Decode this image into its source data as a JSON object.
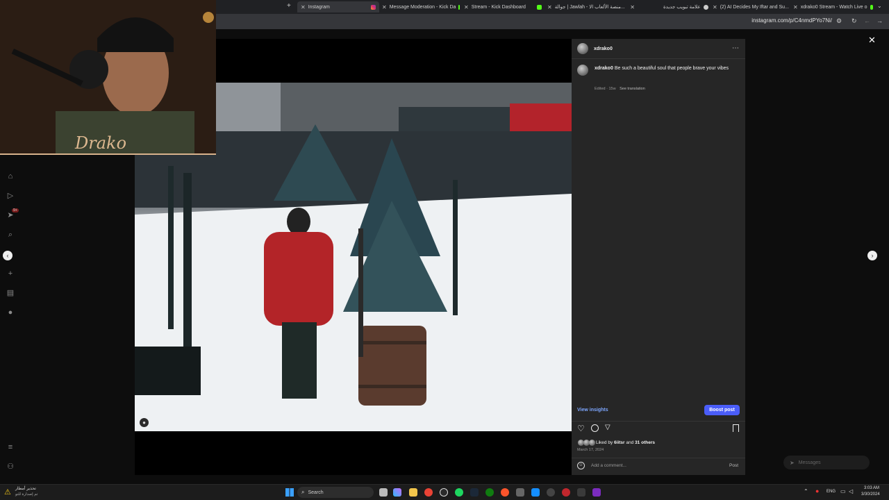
{
  "browser": {
    "tabs": [
      {
        "label": "Instagram",
        "active": true
      },
      {
        "label": "Message Moderation - Kick Da"
      },
      {
        "label": "Stream - Kick Dashboard"
      },
      {
        "label": "جوالة | Jawlah - منصة الألعاب الا..."
      },
      {
        "label": "علامة تبويب جديدة"
      },
      {
        "label": "(2) AI Decides My Iftar and Su..."
      },
      {
        "label": "xdrako0 Stream - Watch Live o"
      }
    ],
    "url": "instagram.com/p/C4nmdPYo7Ni/"
  },
  "webcam": {
    "signature": "Drako"
  },
  "sidebar": {
    "badge": "9+"
  },
  "post": {
    "username": "xdrako0",
    "caption_user": "xdrako0",
    "caption_text": "Be such a beautiful soul that people brave your vibes",
    "edited": "Edited · 15w",
    "see_translation": "See translation",
    "view_insights": "View insights",
    "boost_post": "Boost post",
    "liked_prefix": "Liked by",
    "liked_user": "6iitsr",
    "liked_and": "and",
    "liked_others": "31 others",
    "date": "March 17, 2024",
    "comment_placeholder": "Add a comment...",
    "post_button": "Post"
  },
  "messages_pill": {
    "label": "Messages"
  },
  "taskbar": {
    "weather_title": "تحذير أمطار",
    "weather_sub": "تم إصدارة للتو",
    "search_label": "Search",
    "lang": "ENG",
    "time": "3:03 AM",
    "date": "3/30/2024"
  },
  "colors": {
    "accent": "#4a5df9",
    "link": "#7ea7ff",
    "panel": "#262626"
  }
}
